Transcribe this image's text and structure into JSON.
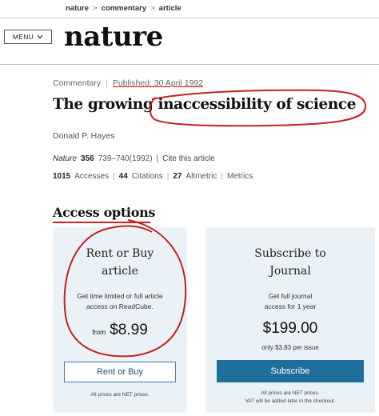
{
  "breadcrumb": {
    "items": [
      "nature",
      "commentary",
      "article"
    ],
    "separator": ">"
  },
  "header": {
    "menu_label": "MENU",
    "menu_icon": "chevron-down-icon",
    "logo_text": "nature"
  },
  "article": {
    "type": "Commentary",
    "published": "Published: 30 April 1992",
    "title_prefix": "The growing ",
    "title_highlight": "inaccessibility of science",
    "author": "Donald P. Hayes",
    "journal": "Nature",
    "volume": "356",
    "pages_year": "739–740(1992)",
    "cite_label": "Cite this article",
    "metrics": {
      "accesses_count": "1015",
      "accesses_label": "Accesses",
      "citations_count": "44",
      "citations_label": "Citations",
      "altmetric_count": "27",
      "altmetric_label": "Altmetric",
      "metrics_link": "Metrics"
    }
  },
  "access": {
    "title": "Access options",
    "rent": {
      "title_line1": "Rent or Buy",
      "title_line2": "article",
      "desc_line1": "Get time limited or full article",
      "desc_line2": "access on ReadCube.",
      "from_label": "from",
      "price": "$8.99",
      "button_label": "Rent or Buy",
      "fine_print": "All prices are NET prices."
    },
    "subscribe": {
      "title_line1": "Subscribe to",
      "title_line2": "Journal",
      "desc_line1": "Get full journal",
      "desc_line2": "access for 1 year",
      "price": "$199.00",
      "per_issue": "only $3.83 per issue",
      "button_label": "Subscribe",
      "fine_line1": "All prices are NET prices.",
      "fine_line2": "VAT will be added later in the checkout."
    }
  },
  "colors": {
    "annotation_red": "#c62020",
    "panel_bg": "#eaf1f7",
    "subscribe_button": "#1f6f9c"
  }
}
